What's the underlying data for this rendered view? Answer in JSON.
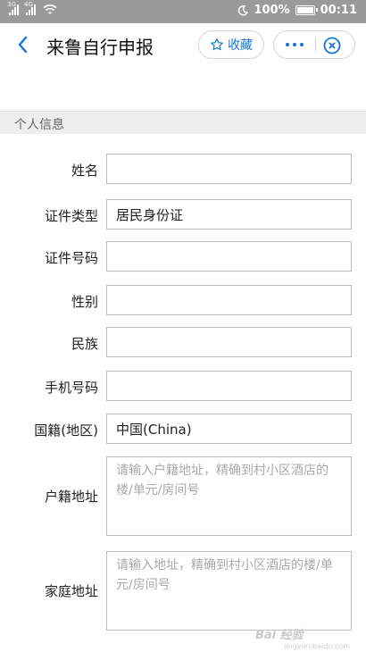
{
  "status_bar": {
    "signal1_tag": "3G",
    "signal2_tag": "4G",
    "battery": "100%",
    "time": "00:11"
  },
  "header": {
    "title": "来鲁自行申报",
    "favorite_label": "收藏"
  },
  "section": {
    "title": "个人信息"
  },
  "form": {
    "name": {
      "label": "姓名",
      "value": ""
    },
    "id_type": {
      "label": "证件类型",
      "value": "居民身份证"
    },
    "id_number": {
      "label": "证件号码",
      "value": ""
    },
    "gender": {
      "label": "性别",
      "value": ""
    },
    "ethnicity": {
      "label": "民族",
      "value": ""
    },
    "phone": {
      "label": "手机号码",
      "value": ""
    },
    "nationality": {
      "label": "国籍(地区)",
      "value": "中国(China)"
    },
    "household_address": {
      "label": "户籍地址",
      "placeholder": "请输入户籍地址，精确到村小区酒店的楼/单元/房间号"
    },
    "home_address": {
      "label": "家庭地址",
      "placeholder": "请输入地址，精确到村小区酒店的楼/单元/房间号"
    }
  },
  "watermark": {
    "brand": "Bai 经验",
    "sub": "jingyan.baidu.com"
  },
  "colors": {
    "accent": "#1677d8",
    "status_bar": "#9a9a9a",
    "section_bg": "#eeeeee",
    "field_border": "#bdbdbd"
  }
}
